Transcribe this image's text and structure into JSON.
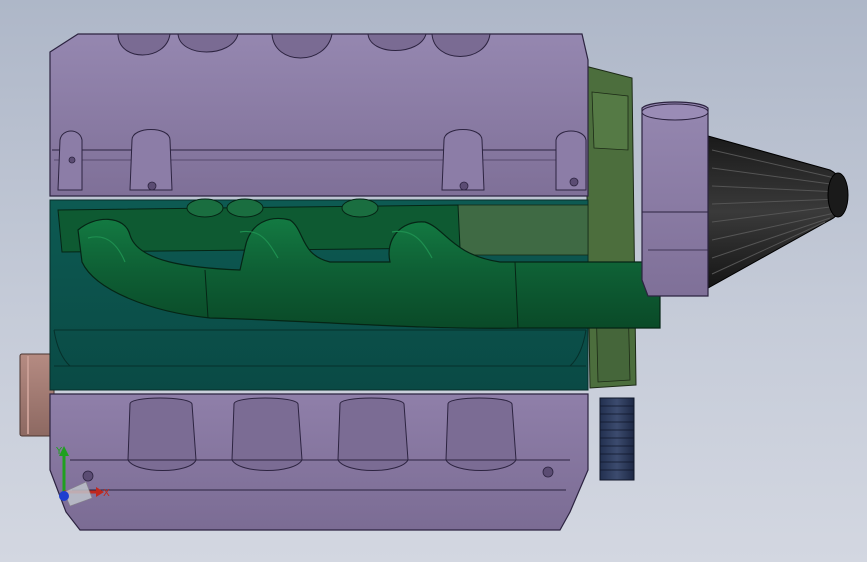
{
  "viewport": {
    "background_top": "#aeb7c8",
    "background_bottom": "#d3d7e1"
  },
  "model": {
    "parts": [
      {
        "name": "cylinder-head",
        "color": "#8a7ba3"
      },
      {
        "name": "engine-block",
        "color": "#0f5a53"
      },
      {
        "name": "exhaust-manifold",
        "color": "#0f5f36"
      },
      {
        "name": "rear-housing",
        "color": "#4a6b3b"
      },
      {
        "name": "turbo-housing",
        "color": "#8a7ba3"
      },
      {
        "name": "air-filter",
        "color": "#2a2a2a"
      },
      {
        "name": "flywheel",
        "color": "#2c3a57"
      },
      {
        "name": "crank-pulley",
        "color": "#a37c74"
      },
      {
        "name": "oil-pan",
        "color": "#8a7ba3"
      }
    ]
  },
  "triad": {
    "y_label": "Y",
    "x_label": "X",
    "y_color": "#1fa01f",
    "x_color": "#c0281e",
    "z_color": "#1e3fcf"
  }
}
